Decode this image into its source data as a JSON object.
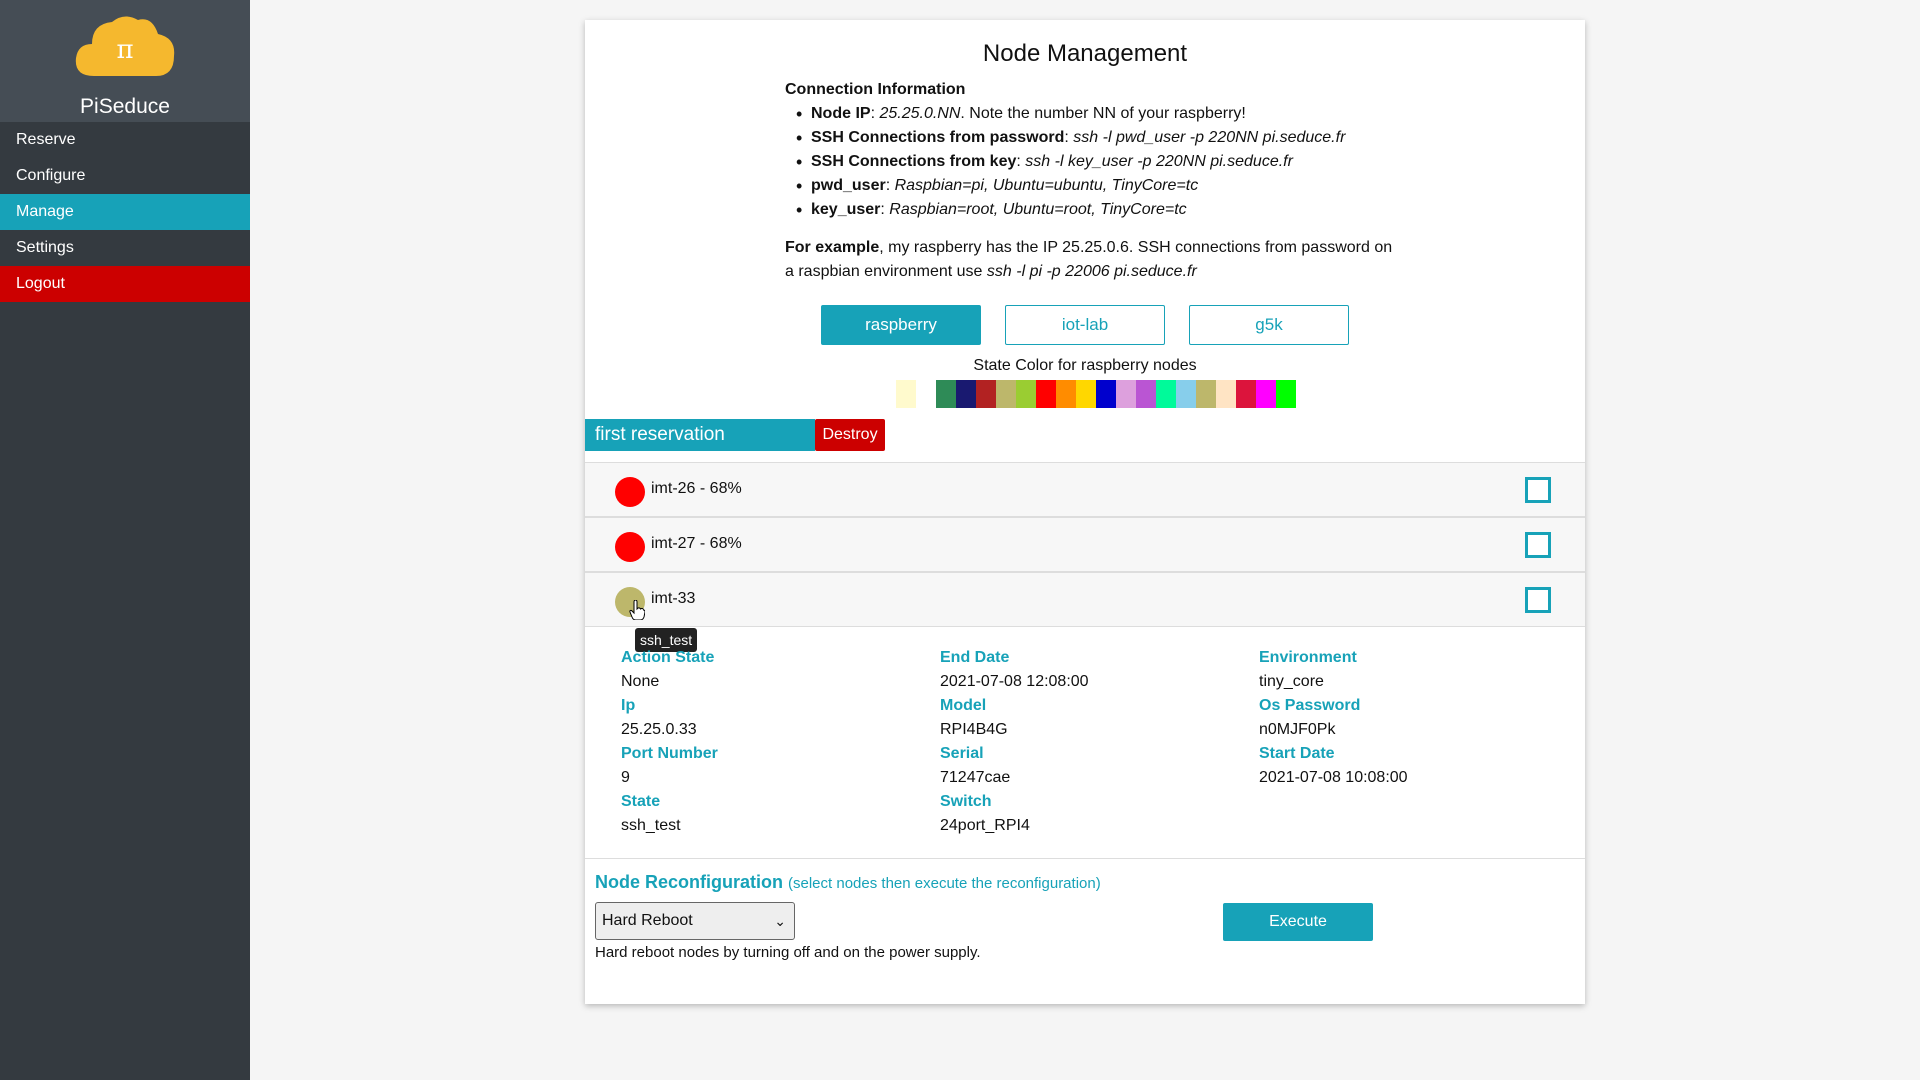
{
  "brand": {
    "name": "PiSeduce",
    "logo_symbol": "π",
    "logo_color": "#f5b82e"
  },
  "sidebar": {
    "items": [
      {
        "label": "Reserve"
      },
      {
        "label": "Configure"
      },
      {
        "label": "Manage",
        "active": true
      },
      {
        "label": "Settings"
      },
      {
        "label": "Logout"
      }
    ]
  },
  "page": {
    "title": "Node Management"
  },
  "connection": {
    "title": "Connection Information",
    "items": [
      {
        "label": "Node IP",
        "value": "25.25.0.NN",
        "note": ". Note the number NN of your raspberry!"
      },
      {
        "label": "SSH Connections from password",
        "value": "ssh -l pwd_user -p 220NN pi.seduce.fr"
      },
      {
        "label": "SSH Connections from key",
        "value": "ssh -l key_user -p 220NN pi.seduce.fr"
      },
      {
        "label": "pwd_user",
        "value": "Raspbian=pi, Ubuntu=ubuntu, TinyCore=tc"
      },
      {
        "label": "key_user",
        "value": "Raspbian=root, Ubuntu=root, TinyCore=tc"
      }
    ],
    "example_label": "For example",
    "example_text": ", my raspberry has the IP 25.25.0.6. SSH connections from password on a raspbian environment use ",
    "example_cmd": "ssh -l pi -p 22006 pi.seduce.fr"
  },
  "tabs": [
    {
      "label": "raspberry",
      "active": true
    },
    {
      "label": "iot-lab"
    },
    {
      "label": "g5k"
    }
  ],
  "state_colors": {
    "label": "State Color for raspberry nodes",
    "colors": [
      "#fffacd",
      "#ffffff",
      "#2e8b57",
      "#191970",
      "#b22222",
      "#bdb76b",
      "#9acd32",
      "#ff0000",
      "#ff8c00",
      "#ffd700",
      "#0000cd",
      "#dda0dd",
      "#ba55d3",
      "#00fa9a",
      "#87ceeb",
      "#bdb76b",
      "#ffe4c4",
      "#dc143c",
      "#ff00ff",
      "#00ff00"
    ]
  },
  "reservation": {
    "name": "first reservation",
    "destroy_label": "Destroy"
  },
  "nodes": [
    {
      "name": "imt-26 - 68%",
      "color": "#ff0000"
    },
    {
      "name": "imt-27 - 68%",
      "color": "#ff0000"
    },
    {
      "name": "imt-33",
      "color": "#bdb76b"
    }
  ],
  "tooltip": "ssh_test",
  "details": {
    "col1": [
      {
        "label": "Action State",
        "value": "None"
      },
      {
        "label": "Ip",
        "value": "25.25.0.33"
      },
      {
        "label": "Port Number",
        "value": "9"
      },
      {
        "label": "State",
        "value": "ssh_test"
      }
    ],
    "col2": [
      {
        "label": "End Date",
        "value": "2021-07-08 12:08:00"
      },
      {
        "label": "Model",
        "value": "RPI4B4G"
      },
      {
        "label": "Serial",
        "value": "71247cae"
      },
      {
        "label": "Switch",
        "value": "24port_RPI4"
      }
    ],
    "col3": [
      {
        "label": "Environment",
        "value": "tiny_core"
      },
      {
        "label": "Os Password",
        "value": "n0MJF0Pk"
      },
      {
        "label": "Start Date",
        "value": "2021-07-08 10:08:00"
      }
    ]
  },
  "reconfiguration": {
    "title": "Node Reconfiguration",
    "hint": "(select nodes then execute the reconfiguration)",
    "selected": "Hard Reboot",
    "help": "Hard reboot nodes by turning off and on the power supply.",
    "execute_label": "Execute"
  },
  "accent_color": "#17a2b8",
  "danger_color": "#cc0000"
}
